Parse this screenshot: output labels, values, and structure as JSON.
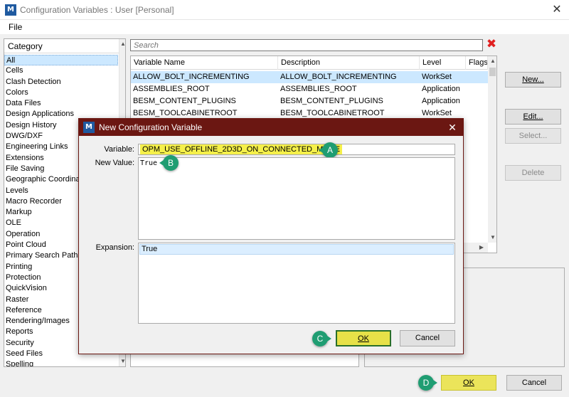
{
  "window": {
    "title": "Configuration Variables : User [Personal]",
    "logo": "M",
    "close_icon": "✕"
  },
  "menu": {
    "file": "File"
  },
  "category": {
    "header": "Category",
    "items": [
      "All",
      "Cells",
      "Clash Detection",
      "Colors",
      "Data Files",
      "Design Applications",
      "Design History",
      "DWG/DXF",
      "Engineering Links",
      "Extensions",
      "File Saving",
      "Geographic Coordinate",
      "Levels",
      "Macro Recorder",
      "Markup",
      "OLE",
      "Operation",
      "Point Cloud",
      "Primary Search Paths",
      "Printing",
      "Protection",
      "QuickVision",
      "Raster",
      "Reference",
      "Rendering/Images",
      "Reports",
      "Security",
      "Seed Files",
      "Spelling"
    ],
    "selected_index": 0
  },
  "search": {
    "placeholder": "Search",
    "clear_icon": "✖"
  },
  "table": {
    "columns": [
      "Variable Name",
      "Description",
      "Level",
      "Flags"
    ],
    "rows": [
      {
        "name": "ALLOW_BOLT_INCREMENTING",
        "description": "ALLOW_BOLT_INCREMENTING",
        "level": "WorkSet"
      },
      {
        "name": "ASSEMBLIES_ROOT",
        "description": "ASSEMBLIES_ROOT",
        "level": "Application"
      },
      {
        "name": "BESM_CONTENT_PLUGINS",
        "description": "BESM_CONTENT_PLUGINS",
        "level": "Application"
      },
      {
        "name": "BESM_TOOLCABINETROOT",
        "description": "BESM_TOOLCABINETROOT",
        "level": "WorkSet"
      }
    ],
    "selected_index": 0
  },
  "buttons": {
    "new": "New...",
    "edit": "Edit...",
    "select": "Select...",
    "delete": "Delete",
    "ok": "OK",
    "cancel": "Cancel"
  },
  "dialog": {
    "title": "New Configuration Variable",
    "logo": "M",
    "close_icon": "✕",
    "variable_label": "Variable:",
    "variable_value": "OPM_USE_OFFLINE_2D3D_ON_CONNECTED_MODE",
    "new_value_label": "New Value:",
    "new_value": "True",
    "expansion_label": "Expansion:",
    "expansion_value": "True",
    "ok": "OK",
    "cancel": "Cancel"
  },
  "callouts": [
    "A",
    "B",
    "C",
    "D"
  ],
  "colors": {
    "dialog_title": "#6b1712",
    "highlight": "#ebe45a",
    "badge": "#1f9d72",
    "selection": "#cce8ff"
  }
}
